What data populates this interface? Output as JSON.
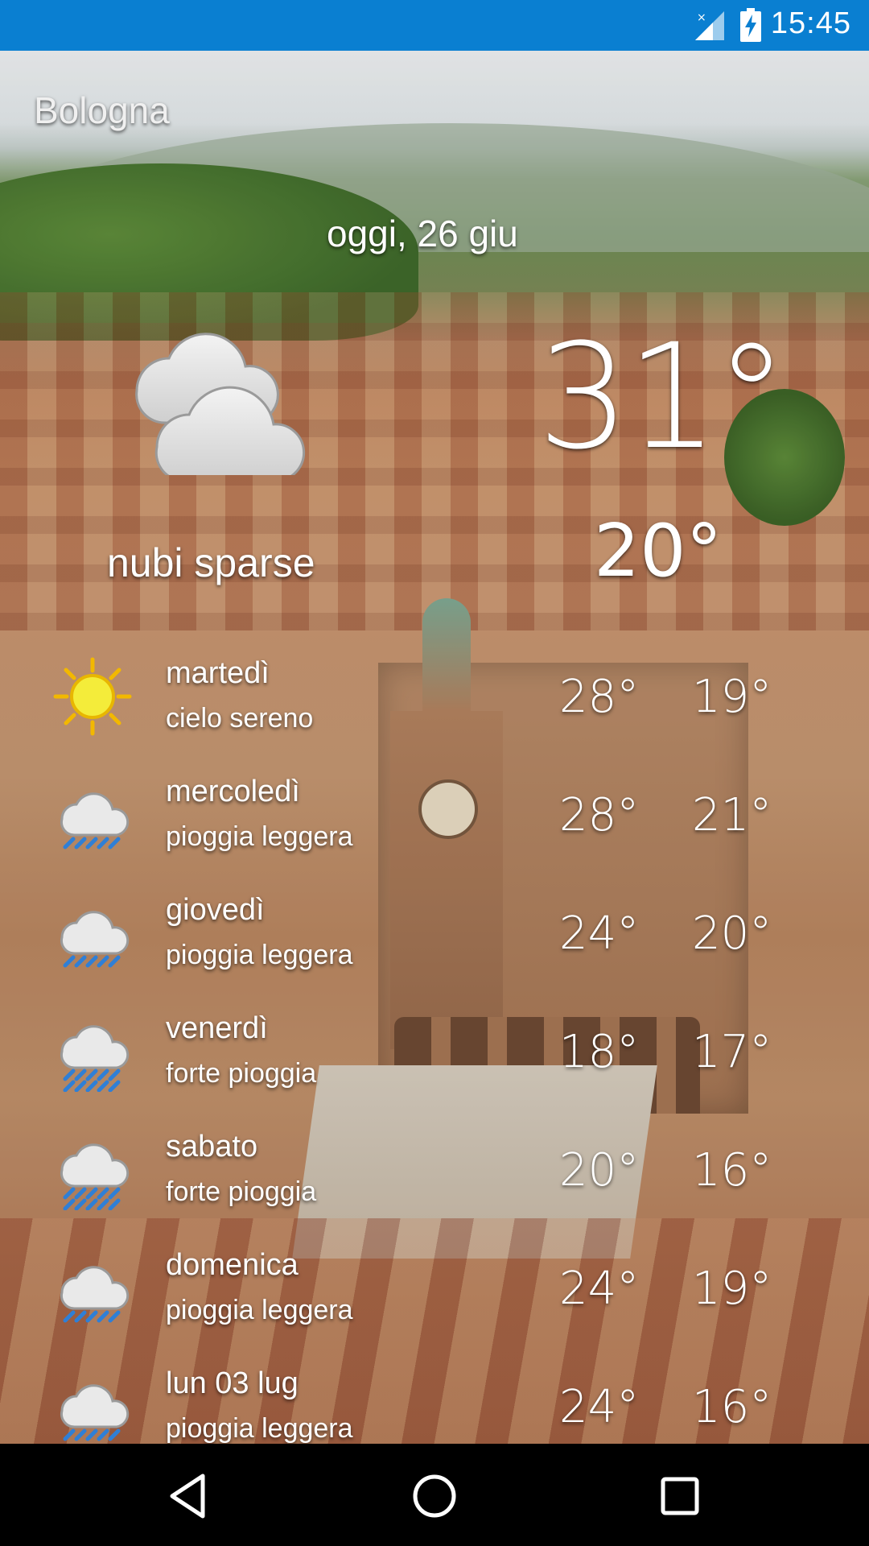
{
  "status_bar": {
    "time": "15:45",
    "signal_icon": "signal-no-data-icon",
    "battery_icon": "battery-charging-icon",
    "background_color": "#0a7fd1"
  },
  "location": {
    "city": "Bologna"
  },
  "today": {
    "date": "oggi, 26 giu",
    "icon": "scattered-clouds-icon",
    "description": "nubi sparse",
    "temp_max": "31°",
    "temp_min": "20°"
  },
  "forecast": [
    {
      "day": "martedì",
      "description": "cielo sereno",
      "hi": "28°",
      "lo": "19°",
      "icon": "sun-icon"
    },
    {
      "day": "mercoledì",
      "description": "pioggia leggera",
      "hi": "28°",
      "lo": "21°",
      "icon": "light-rain-icon"
    },
    {
      "day": "giovedì",
      "description": "pioggia leggera",
      "hi": "24°",
      "lo": "20°",
      "icon": "light-rain-icon"
    },
    {
      "day": "venerdì",
      "description": "forte pioggia",
      "hi": "18°",
      "lo": "17°",
      "icon": "heavy-rain-icon"
    },
    {
      "day": "sabato",
      "description": "forte pioggia",
      "hi": "20°",
      "lo": "16°",
      "icon": "heavy-rain-icon"
    },
    {
      "day": "domenica",
      "description": "pioggia leggera",
      "hi": "24°",
      "lo": "19°",
      "icon": "light-rain-icon"
    },
    {
      "day": "lun 03 lug",
      "description": "pioggia leggera",
      "hi": "24°",
      "lo": "16°",
      "icon": "light-rain-icon"
    }
  ],
  "nav_bar": {
    "back_icon": "back-triangle-icon",
    "home_icon": "home-circle-icon",
    "recents_icon": "recents-square-icon"
  }
}
